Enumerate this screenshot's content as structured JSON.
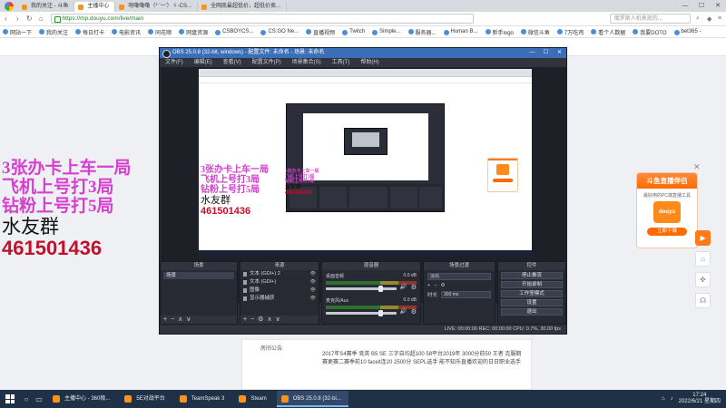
{
  "browser": {
    "tabs": [
      {
        "label": "我的关注 - 斗鱼",
        "active": false
      },
      {
        "label": "主播中心",
        "active": true
      },
      {
        "label": "呀嘞嘞嘞（* 'ー'）ゞ-CS...",
        "active": false
      },
      {
        "label": "全网底最超低价，超低价卖...",
        "active": false
      }
    ],
    "url": "https://mp.douyu.com/live/main",
    "search_placeholder": "俄罗斯人机表现的...",
    "bookmarks": [
      "网站一下",
      "我的关注",
      "每日打卡",
      "电影资讯",
      "同花顺",
      "网盘资源",
      "CSBOYCS...",
      "CS:GO Ne...",
      "直播视频",
      "Twitch",
      "Simple...",
      "服务器...",
      "Human B...",
      "新手logo",
      "微信斗鱼",
      "7万吃鸡",
      "看个人数据",
      "我要DOTO",
      "bet365 -"
    ]
  },
  "overlay_text": {
    "line1": "3张办卡上车一局",
    "line2": "飞机上号打3局",
    "line3": "钻粉上号打5局",
    "line4": "水友群",
    "line5": "461501436"
  },
  "promo": {
    "title": "斗鱼直播伴侣",
    "subtitle": "最好用的PC端直播工具",
    "logo": "douyu",
    "button": "立即下载"
  },
  "notice": {
    "title": "房间公告:",
    "body": "2017年S4赛季 竞英 B5 SE 三字自均超100 58平台2019年 3000分前50 王者 克服期赛更赛二赛季前10 faceit连20 2500分 SEPL选手 能不知乐直播欢迎的日日职业选手"
  },
  "obs": {
    "title": "OBS 25.0.8 (32-bit, windows) - 配置文件: 未命名 - 场景: 未命名",
    "menu": [
      "文件(F)",
      "编辑(E)",
      "查看(V)",
      "配置文件(P)",
      "场景集合(S)",
      "工具(T)",
      "帮助(H)"
    ],
    "docks": {
      "scenes": {
        "title": "场景",
        "items": [
          "场景"
        ]
      },
      "sources": {
        "title": "来源",
        "items": [
          "文本 (GDI+) 2",
          "文本 (GDI+)",
          "图像",
          "显示器捕获"
        ]
      },
      "mixer": {
        "title": "混音器",
        "channels": [
          {
            "name": "桌面音频",
            "db": "0.0 dB"
          },
          {
            "name": "麦克风/Aux",
            "db": "0.0 dB"
          }
        ]
      },
      "transitions": {
        "title": "场景过渡",
        "type": "淡出",
        "duration_label": "时长",
        "duration": "300 ms"
      },
      "controls": {
        "title": "控件",
        "buttons": [
          "停止推流",
          "开始录制",
          "工作室模式",
          "设置",
          "退出"
        ]
      }
    },
    "status": "LIVE: 00:00:00  REC: 00:00:00  CPU: 0.7%, 30.00 fps"
  },
  "taskbar": {
    "tasks": [
      {
        "label": "主播中心 - 360极...",
        "active": false
      },
      {
        "label": "5E对战平台",
        "active": false
      },
      {
        "label": "TeamSpeak 3",
        "active": false
      },
      {
        "label": "Steam",
        "active": false
      },
      {
        "label": "OBS 25.0.8 (32-bi...",
        "active": true
      }
    ],
    "time": "17:24",
    "date": "2022/6/21 星期四"
  }
}
